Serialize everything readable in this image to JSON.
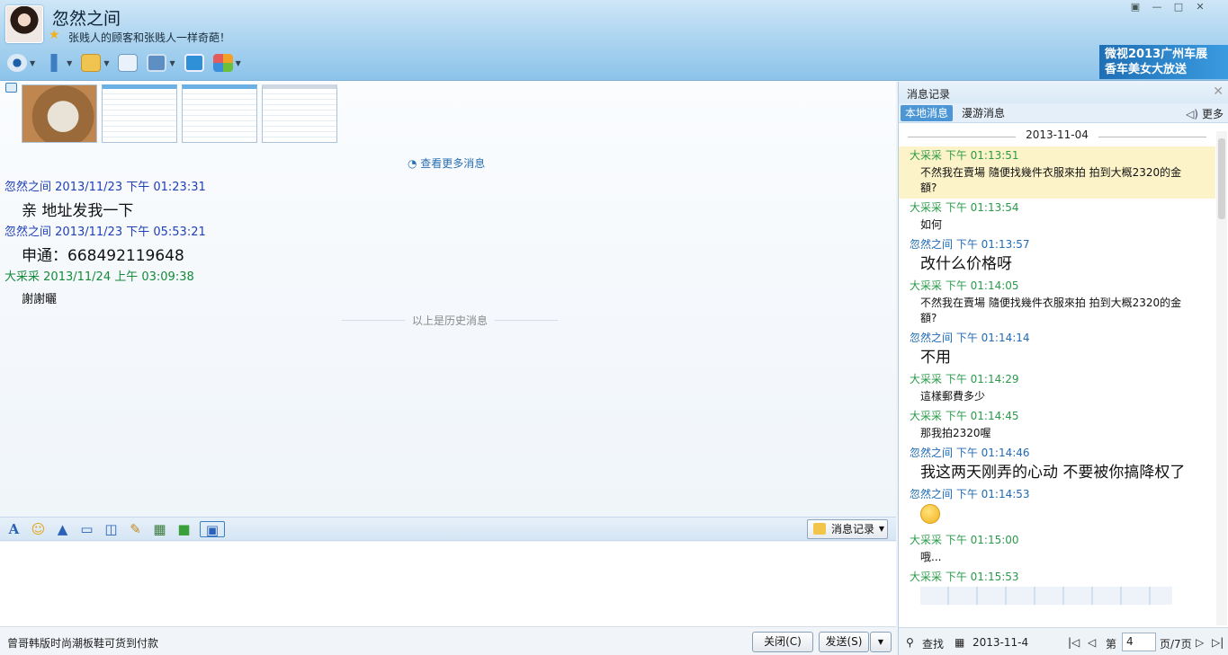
{
  "window": {
    "title": "忽然之间",
    "signature": "张贱人的顾客和张贱人一样奇葩！"
  },
  "banner": {
    "text": "微视2013广州车展 香车美女大放送"
  },
  "chat": {
    "more_link": "查看更多消息",
    "messages": [
      {
        "sender": "忽然之间",
        "time": "2013/11/23 下午 01:23:31",
        "text": "亲  地址发我一下"
      },
      {
        "sender": "忽然之间",
        "time": "2013/11/23 下午 05:53:21",
        "text": "申通：668492119648"
      },
      {
        "sender": "大采采",
        "time": "2013/11/24 上午 03:09:38",
        "text": "謝謝曬"
      }
    ],
    "history_divider": "以上是历史消息"
  },
  "midbar": {
    "history_button": "消息记录"
  },
  "bottom": {
    "status": "曾哥韩版时尚潮板鞋可货到付款",
    "close_button": "关闭(C)",
    "send_button": "发送(S)"
  },
  "panel": {
    "title": "消息记录",
    "tabs": [
      "本地消息",
      "漫游消息"
    ],
    "more": "更多",
    "date": "2013-11-04",
    "items": [
      {
        "name": "大采采 下午 01:13:51",
        "text": "不然我在賣場 隨便找幾件衣服來拍 拍到大概2320的金額?"
      },
      {
        "name": "大采采 下午 01:13:54",
        "text": "如何"
      },
      {
        "name": "忽然之间 下午 01:13:57",
        "text": "改什么价格呀"
      },
      {
        "name": "大采采 下午 01:14:05",
        "text": "不然我在賣場 隨便找幾件衣服來拍 拍到大概2320的金額?"
      },
      {
        "name": "忽然之间 下午 01:14:14",
        "text": "不用"
      },
      {
        "name": "大采采 下午 01:14:29",
        "text": "這樣郵費多少"
      },
      {
        "name": "大采采 下午 01:14:45",
        "text": "那我拍2320喔"
      },
      {
        "name": "忽然之间 下午 01:14:46",
        "text": "我这两天刚弄的心动  不要被你搞降权了"
      },
      {
        "name": "忽然之间 下午 01:14:53",
        "text": ""
      },
      {
        "name": "大采采 下午 01:15:00",
        "text": "哦..."
      },
      {
        "name": "大采采 下午 01:15:53",
        "text": ""
      }
    ],
    "footer": {
      "search": "查找",
      "date": "2013-11-4",
      "page_label": "第",
      "page_value": "4",
      "page_total": "页/7页"
    }
  }
}
